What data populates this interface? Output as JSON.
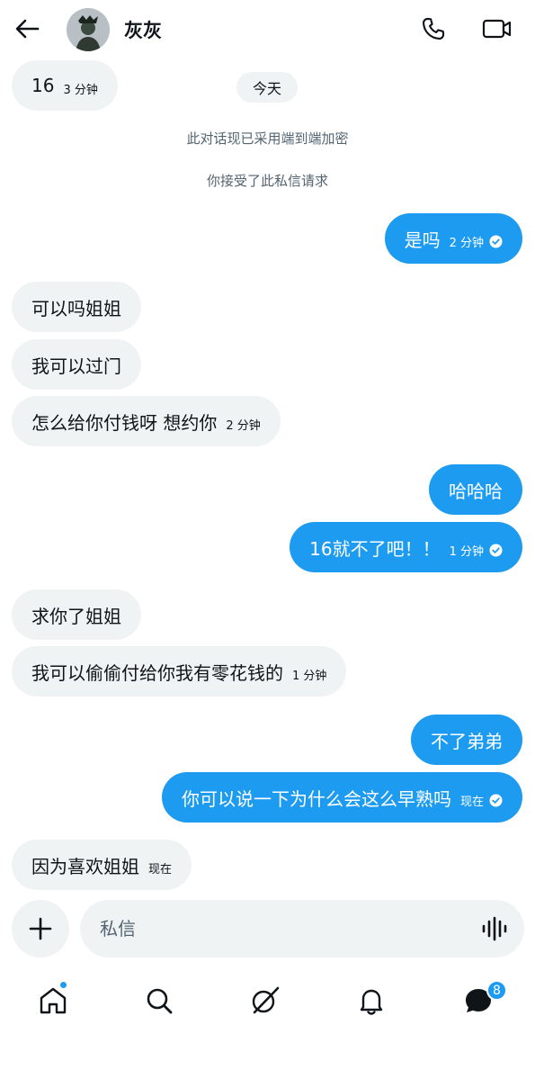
{
  "header": {
    "contact_name": "灰灰",
    "back_icon": "arrow-left-icon",
    "call_icon": "phone-icon",
    "video_icon": "video-camera-icon"
  },
  "day_divider": "今天",
  "system_notices": [
    "此对话现已采用端到端加密",
    "你接受了此私信请求"
  ],
  "messages": [
    {
      "side": "in",
      "text": "16",
      "time": "3 分钟"
    },
    {
      "side": "out",
      "text": "是吗",
      "time": "2 分钟",
      "read": true
    },
    {
      "side": "in",
      "text": "可以吗姐姐",
      "time": ""
    },
    {
      "side": "in",
      "text": "我可以过门",
      "time": ""
    },
    {
      "side": "in",
      "text": "怎么给你付钱呀 想约你",
      "time": "2 分钟"
    },
    {
      "side": "out",
      "text": "哈哈哈",
      "time": ""
    },
    {
      "side": "out",
      "text": "16就不了吧！！",
      "time": "1 分钟",
      "read": true
    },
    {
      "side": "in",
      "text": "求你了姐姐",
      "time": ""
    },
    {
      "side": "in",
      "text": "我可以偷偷付给你我有零花钱的",
      "time": "1 分钟"
    },
    {
      "side": "out",
      "text": "不了弟弟",
      "time": ""
    },
    {
      "side": "out",
      "text": "你可以说一下为什么会这么早熟吗",
      "time": "现在",
      "read": true
    },
    {
      "side": "in",
      "text": "因为喜欢姐姐",
      "time": "现在"
    }
  ],
  "composer": {
    "placeholder": "私信",
    "add_icon": "plus-icon",
    "voice_icon": "voice-wave-icon"
  },
  "bottom_nav": {
    "items": [
      "home-icon",
      "search-icon",
      "grok-icon",
      "bell-icon",
      "messages-icon"
    ],
    "messages_badge": "8"
  },
  "colors": {
    "accent": "#1d9bf0",
    "incoming_bubble": "#eff3f4",
    "secondary_text": "#536471"
  }
}
